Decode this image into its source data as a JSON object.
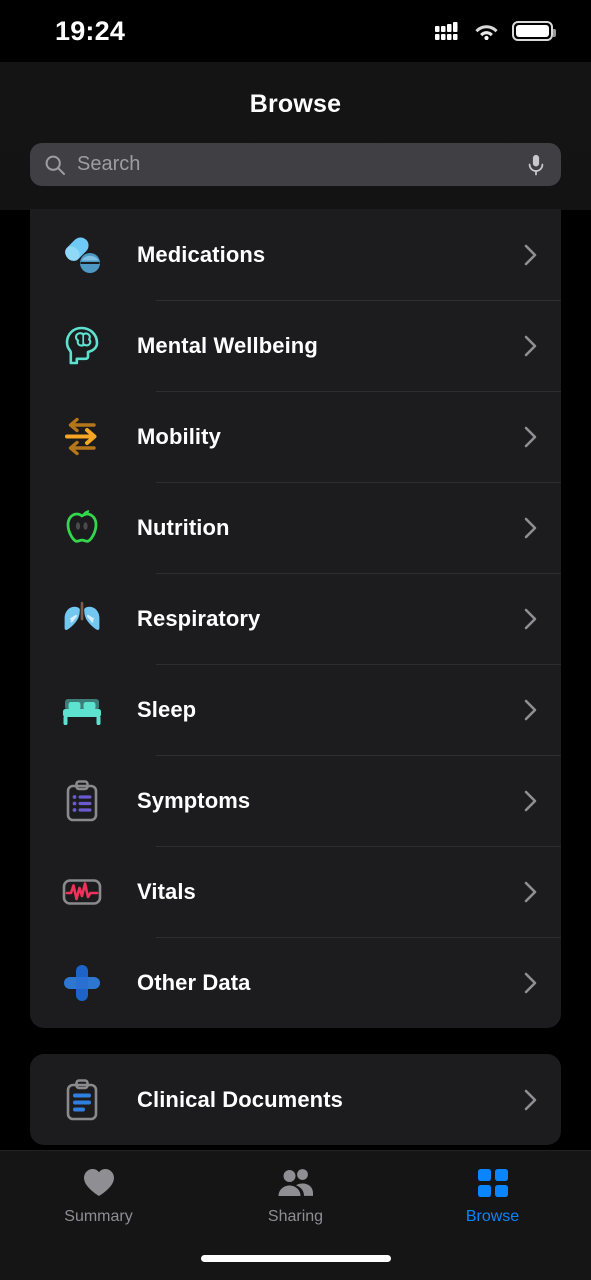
{
  "status_bar": {
    "time": "19:24",
    "cellular_icon": "cellular-bars-icon",
    "wifi_icon": "wifi-icon",
    "battery_icon": "battery-full-icon"
  },
  "header": {
    "title": "Browse",
    "search": {
      "placeholder": "Search",
      "value": "",
      "search_icon": "search-icon",
      "mic_icon": "microphone-icon"
    }
  },
  "colors": {
    "accent": "#0A84FF",
    "card_background": "#1C1C1E",
    "page_background": "#000000",
    "separator": "#2E2E30",
    "secondary_text": "#8E8E93"
  },
  "categories": [
    {
      "label": "Medications",
      "icon": "pills-icon",
      "color": "#5AC8FA",
      "chevron": "chevron-right-icon"
    },
    {
      "label": "Mental Wellbeing",
      "icon": "head-brain-icon",
      "color": "#5DE2D0",
      "chevron": "chevron-right-icon"
    },
    {
      "label": "Mobility",
      "icon": "arrows-mobility-icon",
      "color": "#F5A623",
      "chevron": "chevron-right-icon"
    },
    {
      "label": "Nutrition",
      "icon": "apple-icon",
      "color": "#32D74B",
      "chevron": "chevron-right-icon"
    },
    {
      "label": "Respiratory",
      "icon": "lungs-icon",
      "color": "#64C8F5",
      "chevron": "chevron-right-icon"
    },
    {
      "label": "Sleep",
      "icon": "bed-icon",
      "color": "#5DE2D0",
      "chevron": "chevron-right-icon"
    },
    {
      "label": "Symptoms",
      "icon": "clipboard-list-icon",
      "color": "#6A5ACD",
      "chevron": "chevron-right-icon"
    },
    {
      "label": "Vitals",
      "icon": "ecg-monitor-icon",
      "color": "#F0325A",
      "chevron": "chevron-right-icon"
    },
    {
      "label": "Other Data",
      "icon": "plus-cross-icon",
      "color": "#1E6FD9",
      "chevron": "chevron-right-icon"
    }
  ],
  "documents": [
    {
      "label": "Clinical Documents",
      "icon": "clipboard-documents-icon",
      "color": "#2F7FE0",
      "chevron": "chevron-right-icon"
    }
  ],
  "tab_bar": [
    {
      "label": "Summary",
      "icon": "heart-icon",
      "active": false
    },
    {
      "label": "Sharing",
      "icon": "people-icon",
      "active": false
    },
    {
      "label": "Browse",
      "icon": "grid-icon",
      "active": true
    }
  ]
}
